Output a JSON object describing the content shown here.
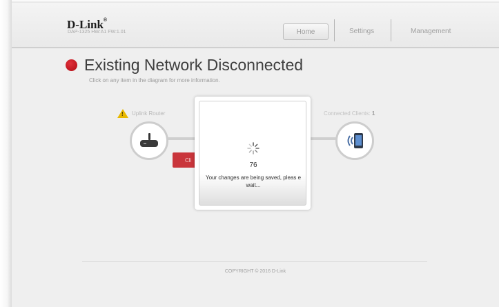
{
  "header": {
    "brand": "D-Link",
    "model_info": "DAP-1325   HW:A1   FW:1.01",
    "nav": [
      {
        "label": "Home",
        "active": true
      },
      {
        "label": "Settings",
        "active": false
      },
      {
        "label": "Management",
        "active": false
      }
    ]
  },
  "main": {
    "status_color": "#c4161e",
    "title": "Existing Network Disconnected",
    "subtitle": "Click on any item in the diagram for more information.",
    "uplink_label": "Uplink Router",
    "clients_label": "Connected Clients:",
    "clients_count": "1",
    "button_label": "Cli",
    "warning_icon": "warning-icon",
    "router_icon": "router-icon",
    "client_icon": "wireless-device-icon"
  },
  "modal": {
    "spinner_icon": "loading-spinner-icon",
    "countdown": "76",
    "message": "Your changes are being saved, pleas e wait..."
  },
  "footer": {
    "copyright": "COPYRIGHT © 2016 D-Link"
  }
}
